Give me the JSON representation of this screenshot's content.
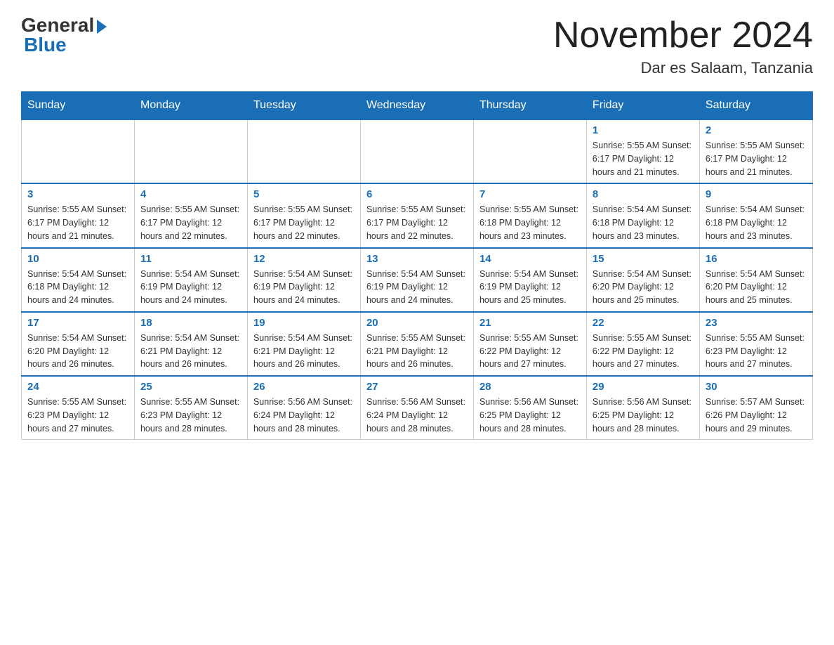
{
  "header": {
    "logo_general": "General",
    "logo_blue": "Blue",
    "title": "November 2024",
    "location": "Dar es Salaam, Tanzania"
  },
  "weekdays": [
    "Sunday",
    "Monday",
    "Tuesday",
    "Wednesday",
    "Thursday",
    "Friday",
    "Saturday"
  ],
  "weeks": [
    [
      {
        "day": "",
        "info": ""
      },
      {
        "day": "",
        "info": ""
      },
      {
        "day": "",
        "info": ""
      },
      {
        "day": "",
        "info": ""
      },
      {
        "day": "",
        "info": ""
      },
      {
        "day": "1",
        "info": "Sunrise: 5:55 AM\nSunset: 6:17 PM\nDaylight: 12 hours\nand 21 minutes."
      },
      {
        "day": "2",
        "info": "Sunrise: 5:55 AM\nSunset: 6:17 PM\nDaylight: 12 hours\nand 21 minutes."
      }
    ],
    [
      {
        "day": "3",
        "info": "Sunrise: 5:55 AM\nSunset: 6:17 PM\nDaylight: 12 hours\nand 21 minutes."
      },
      {
        "day": "4",
        "info": "Sunrise: 5:55 AM\nSunset: 6:17 PM\nDaylight: 12 hours\nand 22 minutes."
      },
      {
        "day": "5",
        "info": "Sunrise: 5:55 AM\nSunset: 6:17 PM\nDaylight: 12 hours\nand 22 minutes."
      },
      {
        "day": "6",
        "info": "Sunrise: 5:55 AM\nSunset: 6:17 PM\nDaylight: 12 hours\nand 22 minutes."
      },
      {
        "day": "7",
        "info": "Sunrise: 5:55 AM\nSunset: 6:18 PM\nDaylight: 12 hours\nand 23 minutes."
      },
      {
        "day": "8",
        "info": "Sunrise: 5:54 AM\nSunset: 6:18 PM\nDaylight: 12 hours\nand 23 minutes."
      },
      {
        "day": "9",
        "info": "Sunrise: 5:54 AM\nSunset: 6:18 PM\nDaylight: 12 hours\nand 23 minutes."
      }
    ],
    [
      {
        "day": "10",
        "info": "Sunrise: 5:54 AM\nSunset: 6:18 PM\nDaylight: 12 hours\nand 24 minutes."
      },
      {
        "day": "11",
        "info": "Sunrise: 5:54 AM\nSunset: 6:19 PM\nDaylight: 12 hours\nand 24 minutes."
      },
      {
        "day": "12",
        "info": "Sunrise: 5:54 AM\nSunset: 6:19 PM\nDaylight: 12 hours\nand 24 minutes."
      },
      {
        "day": "13",
        "info": "Sunrise: 5:54 AM\nSunset: 6:19 PM\nDaylight: 12 hours\nand 24 minutes."
      },
      {
        "day": "14",
        "info": "Sunrise: 5:54 AM\nSunset: 6:19 PM\nDaylight: 12 hours\nand 25 minutes."
      },
      {
        "day": "15",
        "info": "Sunrise: 5:54 AM\nSunset: 6:20 PM\nDaylight: 12 hours\nand 25 minutes."
      },
      {
        "day": "16",
        "info": "Sunrise: 5:54 AM\nSunset: 6:20 PM\nDaylight: 12 hours\nand 25 minutes."
      }
    ],
    [
      {
        "day": "17",
        "info": "Sunrise: 5:54 AM\nSunset: 6:20 PM\nDaylight: 12 hours\nand 26 minutes."
      },
      {
        "day": "18",
        "info": "Sunrise: 5:54 AM\nSunset: 6:21 PM\nDaylight: 12 hours\nand 26 minutes."
      },
      {
        "day": "19",
        "info": "Sunrise: 5:54 AM\nSunset: 6:21 PM\nDaylight: 12 hours\nand 26 minutes."
      },
      {
        "day": "20",
        "info": "Sunrise: 5:55 AM\nSunset: 6:21 PM\nDaylight: 12 hours\nand 26 minutes."
      },
      {
        "day": "21",
        "info": "Sunrise: 5:55 AM\nSunset: 6:22 PM\nDaylight: 12 hours\nand 27 minutes."
      },
      {
        "day": "22",
        "info": "Sunrise: 5:55 AM\nSunset: 6:22 PM\nDaylight: 12 hours\nand 27 minutes."
      },
      {
        "day": "23",
        "info": "Sunrise: 5:55 AM\nSunset: 6:23 PM\nDaylight: 12 hours\nand 27 minutes."
      }
    ],
    [
      {
        "day": "24",
        "info": "Sunrise: 5:55 AM\nSunset: 6:23 PM\nDaylight: 12 hours\nand 27 minutes."
      },
      {
        "day": "25",
        "info": "Sunrise: 5:55 AM\nSunset: 6:23 PM\nDaylight: 12 hours\nand 28 minutes."
      },
      {
        "day": "26",
        "info": "Sunrise: 5:56 AM\nSunset: 6:24 PM\nDaylight: 12 hours\nand 28 minutes."
      },
      {
        "day": "27",
        "info": "Sunrise: 5:56 AM\nSunset: 6:24 PM\nDaylight: 12 hours\nand 28 minutes."
      },
      {
        "day": "28",
        "info": "Sunrise: 5:56 AM\nSunset: 6:25 PM\nDaylight: 12 hours\nand 28 minutes."
      },
      {
        "day": "29",
        "info": "Sunrise: 5:56 AM\nSunset: 6:25 PM\nDaylight: 12 hours\nand 28 minutes."
      },
      {
        "day": "30",
        "info": "Sunrise: 5:57 AM\nSunset: 6:26 PM\nDaylight: 12 hours\nand 29 minutes."
      }
    ]
  ]
}
